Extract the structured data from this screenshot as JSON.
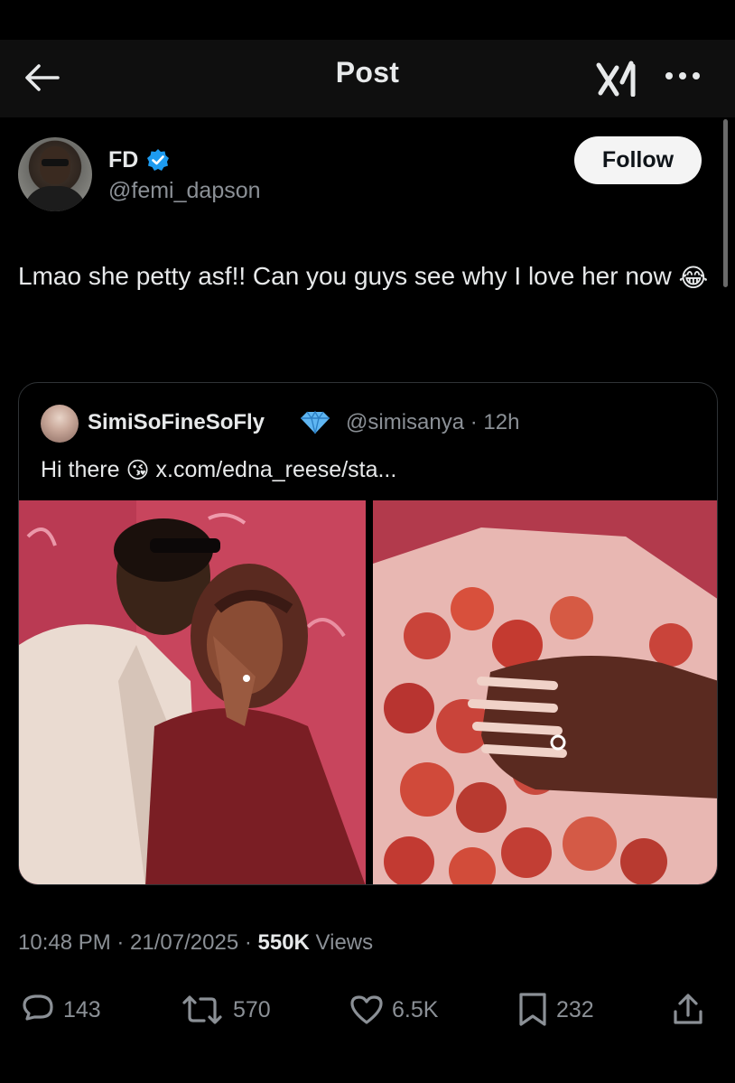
{
  "header": {
    "title": "Post",
    "back_icon": "arrow-left-icon",
    "grok_icon": "grok-logo-icon",
    "more_icon": "more-horizontal-icon"
  },
  "author": {
    "display_name": "FD",
    "handle": "@femi_dapson",
    "verified_color": "#1d9bf0",
    "follow_label": "Follow"
  },
  "post": {
    "text": "Lmao she petty asf!! Can you guys see why I love her now",
    "emoji": "😂"
  },
  "quote": {
    "display_name": "SimiSoFineSoFly",
    "badge_icon": "diamond-icon",
    "handle_time": "@simisanya · 12h",
    "text": "Hi there",
    "emoji": "😘",
    "link": "x.com/edna_reese/sta..."
  },
  "meta": {
    "time_date": "10:48 PM · 21/07/2025 · ",
    "views_count": "550K",
    "views_label": " Views"
  },
  "actions": {
    "replies": "143",
    "reposts": "570",
    "likes": "6.5K",
    "bookmarks": "232"
  },
  "colors": {
    "background": "#000000",
    "text": "#e7e9ea",
    "muted": "#8b9096",
    "border": "#2f3336"
  }
}
